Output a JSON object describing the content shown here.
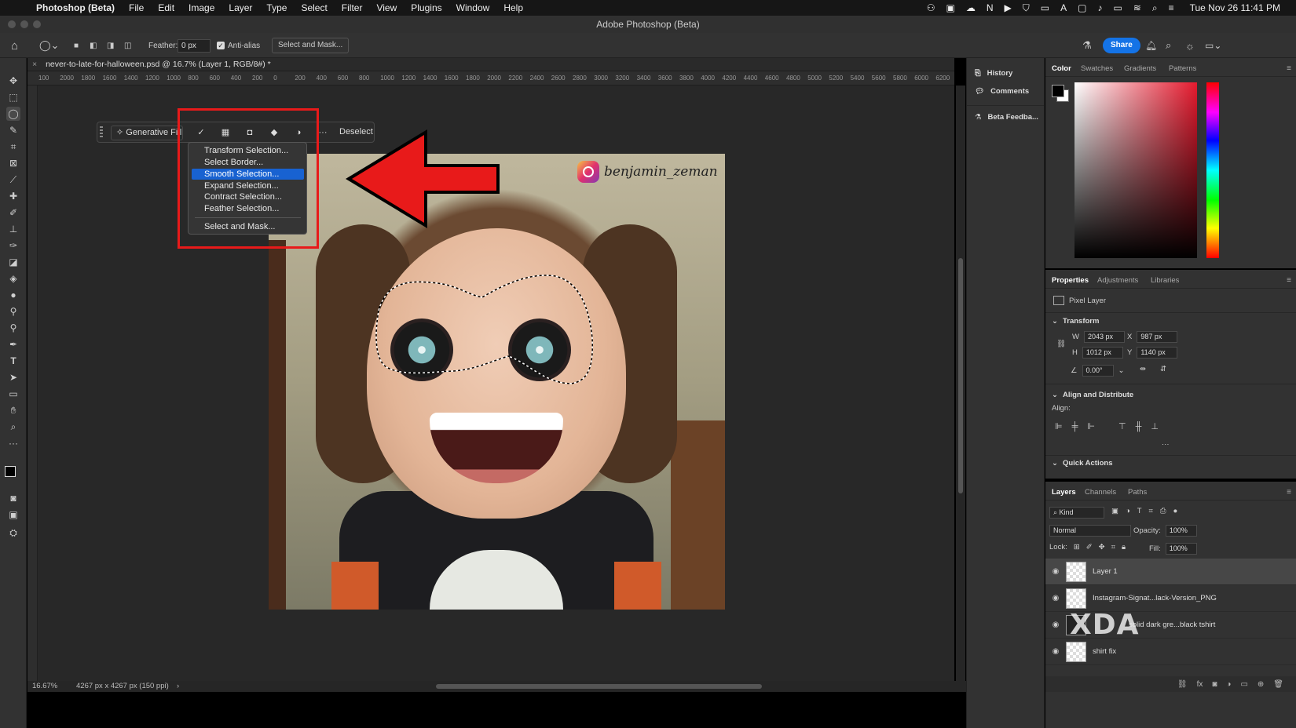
{
  "menubar": {
    "app_name": "Photoshop (Beta)",
    "items": [
      "File",
      "Edit",
      "Image",
      "Layer",
      "Type",
      "Select",
      "Filter",
      "View",
      "Plugins",
      "Window",
      "Help"
    ],
    "clock": "Tue Nov 26  11:41 PM"
  },
  "window": {
    "title": "Adobe Photoshop (Beta)"
  },
  "options": {
    "feather_label": "Feather:",
    "feather_value": "0 px",
    "antialias_label": "Anti-alias",
    "antialias_checked": true,
    "select_mask_label": "Select and Mask...",
    "share_label": "Share"
  },
  "document": {
    "tab_title": "never-to-late-for-halloween.psd @ 16.7% (Layer 1, RGB/8#) *",
    "ruler_labels": [
      "100",
      "2000",
      "1800",
      "1600",
      "1400",
      "1200",
      "1000",
      "800",
      "600",
      "400",
      "200",
      "0",
      "200",
      "400",
      "600",
      "800",
      "1000",
      "1200",
      "1400",
      "1600",
      "1800",
      "2000",
      "2200",
      "2400",
      "2600",
      "2800",
      "3000",
      "3200",
      "3400",
      "3600",
      "3800",
      "4000",
      "4200",
      "4400",
      "4600",
      "4800",
      "5000",
      "5200",
      "5400",
      "5600",
      "5800",
      "6000",
      "6200"
    ],
    "zoom": "16.67%",
    "dimensions": "4267 px x 4267 px (150 ppi)",
    "watermark": "benjamin_zeman"
  },
  "contextual_bar": {
    "generative_fill_label": "Generative Fill",
    "more_label": "···",
    "deselect_label": "Deselect"
  },
  "dropdown": {
    "items": [
      "Transform Selection...",
      "Select Border...",
      "Smooth Selection...",
      "Expand Selection...",
      "Contract Selection...",
      "Feather Selection...",
      "Select and Mask..."
    ],
    "selected": "Smooth Selection..."
  },
  "side_panel": {
    "history": "History",
    "comments": "Comments",
    "beta_feedback": "Beta Feedba..."
  },
  "color_panel": {
    "tabs": [
      "Color",
      "Swatches",
      "Gradients",
      "Patterns"
    ],
    "active_tab": "Color",
    "foreground": "#000000",
    "background": "#ffffff"
  },
  "properties_panel": {
    "tabs": [
      "Properties",
      "Adjustments",
      "Libraries"
    ],
    "layer_type": "Pixel Layer",
    "transform_label": "Transform",
    "w_label": "W",
    "w": "2043 px",
    "h_label": "H",
    "h": "1012 px",
    "x_label": "X",
    "x": "987 px",
    "y_label": "Y",
    "y": "1140 px",
    "angle": "0.00°",
    "align_label": "Align and Distribute",
    "align_sub": "Align:",
    "align_more": "···",
    "quick_actions": "Quick Actions"
  },
  "layers_panel": {
    "tabs": [
      "Layers",
      "Channels",
      "Paths"
    ],
    "filter_kind": "Kind",
    "blend_mode": "Normal",
    "opacity_label": "Opacity:",
    "opacity": "100%",
    "lock_label": "Lock:",
    "fill_label": "Fill:",
    "fill": "100%",
    "layers": [
      {
        "name": "Layer 1",
        "active": true
      },
      {
        "name": "Instagram-Signat...lack-Version_PNG",
        "active": false
      },
      {
        "name": "solid dark gre...black tshirt",
        "active": false
      },
      {
        "name": "shirt fix",
        "active": false
      }
    ]
  },
  "branding": {
    "xda": "XDA"
  },
  "colors": {
    "accent": "#1473e6",
    "annotation_red": "#e81a1a",
    "selected_menu": "#1862d1"
  }
}
